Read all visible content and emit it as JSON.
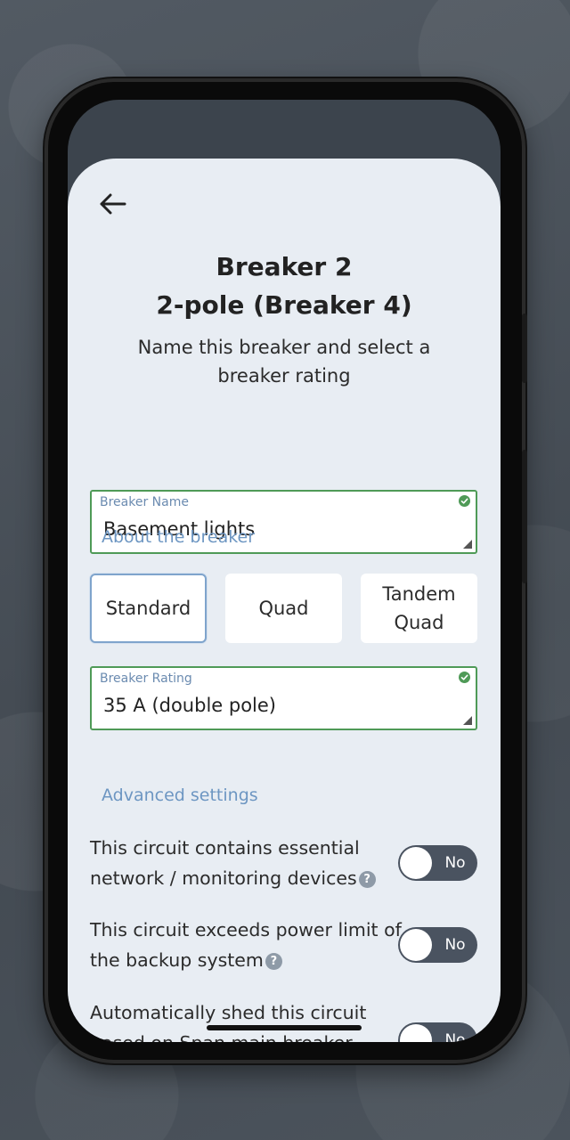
{
  "header": {
    "back_icon": "arrow-left-icon",
    "title_line1": "Breaker 2",
    "title_line2": "2-pole (Breaker 4)",
    "subtitle": "Name this breaker and select a breaker rating"
  },
  "breaker_name": {
    "label": "Breaker Name",
    "value": "Basement lights"
  },
  "about": {
    "heading": "About the breaker",
    "types": [
      {
        "label": "Standard",
        "selected": true
      },
      {
        "label": "Quad",
        "selected": false
      },
      {
        "label": "Tandem Quad",
        "selected": false
      }
    ]
  },
  "breaker_rating": {
    "label": "Breaker Rating",
    "value": "35 A (double pole)"
  },
  "advanced": {
    "heading": "Advanced settings",
    "settings": [
      {
        "text": "This circuit contains essential network / monitoring devices",
        "toggle": "No"
      },
      {
        "text": "This circuit exceeds power limit of the backup system",
        "toggle": "No"
      },
      {
        "text": "Automatically shed this circuit based on Span main breaker",
        "toggle": "No"
      }
    ]
  },
  "colors": {
    "accent": "#6d96c2",
    "valid": "#4f9a57",
    "toggle_off": "#4a5360",
    "screen_bg": "#e8edf3"
  }
}
